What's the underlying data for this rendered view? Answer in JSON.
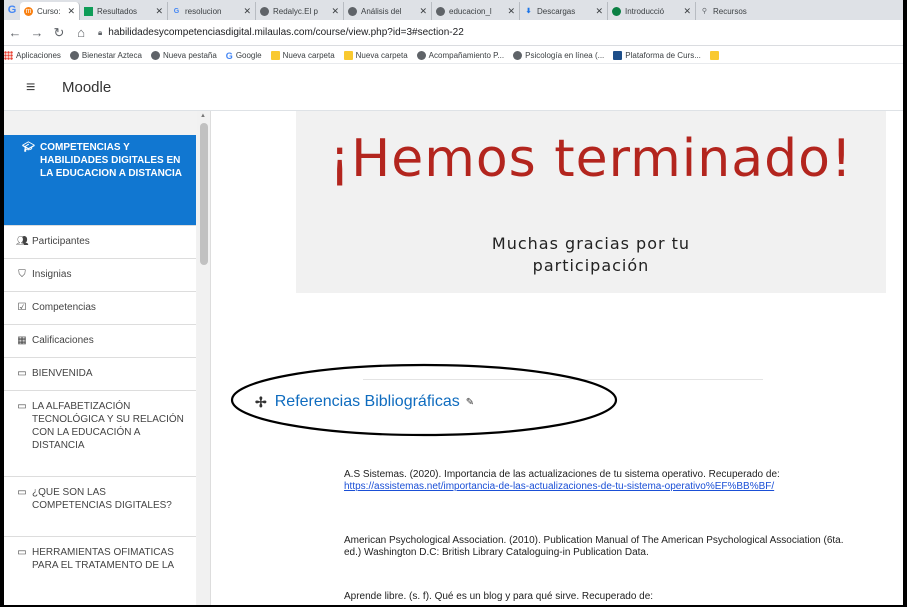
{
  "browser": {
    "tabs": [
      {
        "title": "Curso: COM",
        "icon": "moodle-icon",
        "active": true
      },
      {
        "title": "Resultados",
        "icon": "drive-icon"
      },
      {
        "title": "resolucion",
        "icon": "google-icon"
      },
      {
        "title": "Redalyc.El p",
        "icon": "globe-icon"
      },
      {
        "title": "Análisis del",
        "icon": "globe-icon"
      },
      {
        "title": "educacion_l",
        "icon": "globe-icon"
      },
      {
        "title": "Descargas",
        "icon": "download-icon"
      },
      {
        "title": "Introducció",
        "icon": "globe-icon"
      },
      {
        "title": "Recursos",
        "icon": "globe-icon"
      }
    ],
    "url": "habilidadesycompetenciasdigital.milaulas.com/course/view.php?id=3#section-22",
    "bookmarks": [
      {
        "label": "Aplicaciones",
        "icon": "apps"
      },
      {
        "label": "Bienestar Azteca",
        "icon": "globe"
      },
      {
        "label": "Nueva pestaña",
        "icon": "globe"
      },
      {
        "label": "Google",
        "icon": "google"
      },
      {
        "label": "Nueva carpeta",
        "icon": "folder"
      },
      {
        "label": "Nueva carpeta",
        "icon": "folder"
      },
      {
        "label": "Acompañamiento P...",
        "icon": "globe"
      },
      {
        "label": "Psicología en línea (...",
        "icon": "globe"
      },
      {
        "label": "Plataforma de Curs...",
        "icon": "plat"
      }
    ]
  },
  "header": {
    "brand": "Moodle"
  },
  "drawer": {
    "course_title": "COMPETENCIAS Y HABILIDADES DIGITALES EN LA EDUCACION A DISTANCIA",
    "items": [
      {
        "label": "Participantes",
        "icon": "users-icon"
      },
      {
        "label": "Insignias",
        "icon": "shield-icon"
      },
      {
        "label": "Competencias",
        "icon": "checkbox-icon"
      },
      {
        "label": "Calificaciones",
        "icon": "table-icon"
      },
      {
        "label": "BIENVENIDA",
        "icon": "folder-icon"
      },
      {
        "label": "LA ALFABETIZACIÓN TECNOLÓGICA Y SU RELACIÓN CON LA EDUCACIÓN A DISTANCIA",
        "icon": "folder-icon"
      },
      {
        "label": "¿QUE SON LAS COMPETENCIAS DIGITALES?",
        "icon": "folder-icon"
      },
      {
        "label": "HERRAMIENTAS OFIMATICAS PARA EL TRATAMENTO DE LA",
        "icon": "folder-icon"
      }
    ]
  },
  "main": {
    "banner_title": "¡Hemos terminado!",
    "banner_thanks": "Muchas gracias por tu\nparticipación",
    "section_title": "Referencias Bibliográficas",
    "refs": [
      {
        "text": "A.S Sistemas. (2020). Importancia de las actualizaciones de tu sistema operativo. Recuperado de: ",
        "link": "https://assistemas.net/importancia-de-las-actualizaciones-de-tu-sistema-operativo%EF%BB%BF/"
      },
      {
        "text": "American Psychological Association. (2010). Publication Manual of The American Psychological Association (6ta. ed.) Washington D.C: British Library Cataloguing-in Publication Data.",
        "link": ""
      },
      {
        "text": "Aprende libre. (s. f). Qué es un blog y para qué sirve. Recuperado de:",
        "link": ""
      }
    ]
  }
}
